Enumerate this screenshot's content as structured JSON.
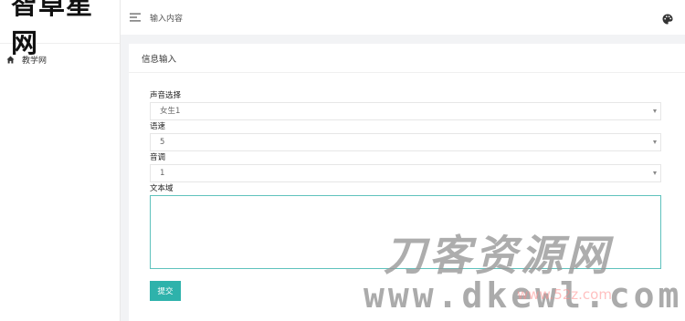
{
  "brand": {
    "title": "智卓星网"
  },
  "sidebar": {
    "items": [
      {
        "label": "教学网",
        "icon": "home-icon"
      }
    ]
  },
  "header": {
    "title": "输入内容",
    "menu_icon": "menu-icon",
    "palette_icon": "palette-icon"
  },
  "card": {
    "title": "信息输入",
    "fields": {
      "voice": {
        "label": "声音选择",
        "value": "女生1"
      },
      "speed": {
        "label": "语速",
        "value": "5"
      },
      "pitch": {
        "label": "音调",
        "value": "1"
      },
      "text": {
        "label": "文本域",
        "value": ""
      }
    },
    "submit_label": "提交"
  },
  "watermark": {
    "line1": "刀客资源网",
    "line2": "www.dkewl.com",
    "line3": "www.52z.com"
  },
  "colors": {
    "accent": "#2eb2ab",
    "focus_border": "#5fc2bd",
    "page_bg": "#f2f3f5"
  }
}
